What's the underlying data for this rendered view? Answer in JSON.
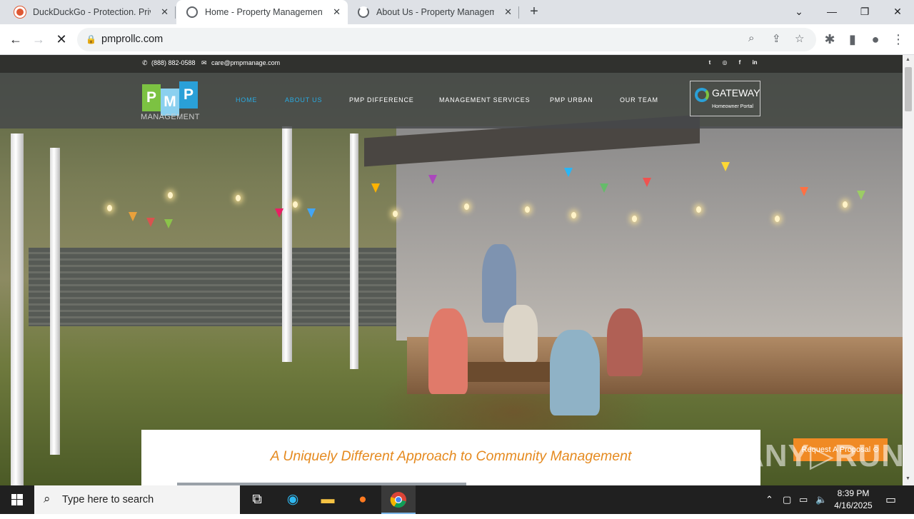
{
  "browser": {
    "tabs": [
      {
        "title": "DuckDuckGo - Protection. Privacy. Peace of mind.",
        "active": false
      },
      {
        "title": "Home - Property Management Professionals",
        "active": true
      },
      {
        "title": "About Us - Property Management Professionals",
        "active": false
      }
    ],
    "url": "pmprollc.com",
    "new_tab": "+"
  },
  "site": {
    "phone": "(888) 882-0588",
    "email": "care@pmpmanage.com",
    "social": [
      "t",
      "◎",
      "f",
      "in"
    ],
    "logo": {
      "letters": [
        "P",
        "M",
        "P"
      ],
      "sub": "MANAGEMENT"
    },
    "nav": [
      {
        "label": "HOME",
        "active": true
      },
      {
        "label": "ABOUT US",
        "active": true
      },
      {
        "label": "PMP DIFFERENCE",
        "active": false
      },
      {
        "label": "MANAGEMENT SERVICES",
        "active": false
      },
      {
        "label": "PMP URBAN",
        "active": false
      },
      {
        "label": "OUR TEAM",
        "active": false
      }
    ],
    "gateway": {
      "title": "GATEWAY",
      "subtitle": "Homeowner Portal"
    },
    "tagline": "A Uniquely Different Approach to Community Management",
    "cta": "Request A Proposal ⊙",
    "watermark": "ANY▷RUN"
  },
  "taskbar": {
    "search_placeholder": "Type here to search",
    "time": "8:39 PM",
    "date": "4/16/2025"
  },
  "colors": {
    "accent": "#29abe2",
    "orange": "#e58a1f",
    "logo_green": "#7cc242",
    "logo_blue": "#2aa0d8"
  }
}
